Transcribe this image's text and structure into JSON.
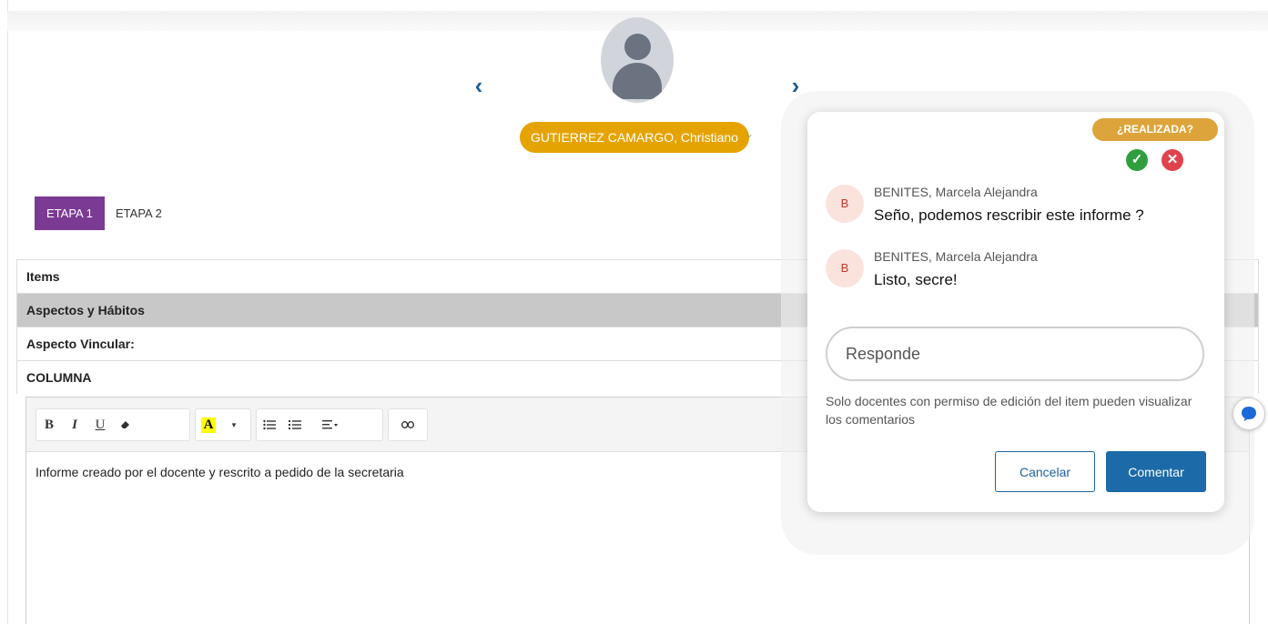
{
  "student": {
    "name": "GUTIERREZ CAMARGO, Christiano",
    "prev_label": "‹",
    "next_label": "›",
    "dropdown_chevron": "⌄"
  },
  "tabs": [
    {
      "label": "ETAPA 1",
      "active": true
    },
    {
      "label": "ETAPA 2",
      "active": false
    }
  ],
  "table": {
    "items_header": "Items",
    "section": "Aspectos y Hábitos",
    "subsection": "Aspecto Vincular:",
    "column_label": "COLUMNA"
  },
  "toolbar": {
    "bold": "B",
    "italic": "I",
    "underline": "U",
    "highlight": "A",
    "highlight_color": "#ffff00"
  },
  "editor": {
    "content": "Informe creado por el docente y rescrito a pedido de la secretaria"
  },
  "popover": {
    "done_label": "¿REALIZADA?",
    "comments": [
      {
        "avatar": "B",
        "author": "BENITES, Marcela Alejandra",
        "text": "Seño, podemos rescribir este informe ?"
      },
      {
        "avatar": "B",
        "author": "BENITES, Marcela Alejandra",
        "text": "Listo, secre!"
      }
    ],
    "reply_placeholder": "Responde",
    "note": "Solo docentes con permiso de edición del item pueden visualizar los comentarios",
    "cancel_label": "Cancelar",
    "comment_label": "Comentar"
  },
  "colors": {
    "accent_purple": "#7b3a93",
    "badge_orange": "#e5a300",
    "primary_blue": "#1c6aa8",
    "ok_green": "#2e9e3e",
    "error_red": "#e0434e"
  }
}
